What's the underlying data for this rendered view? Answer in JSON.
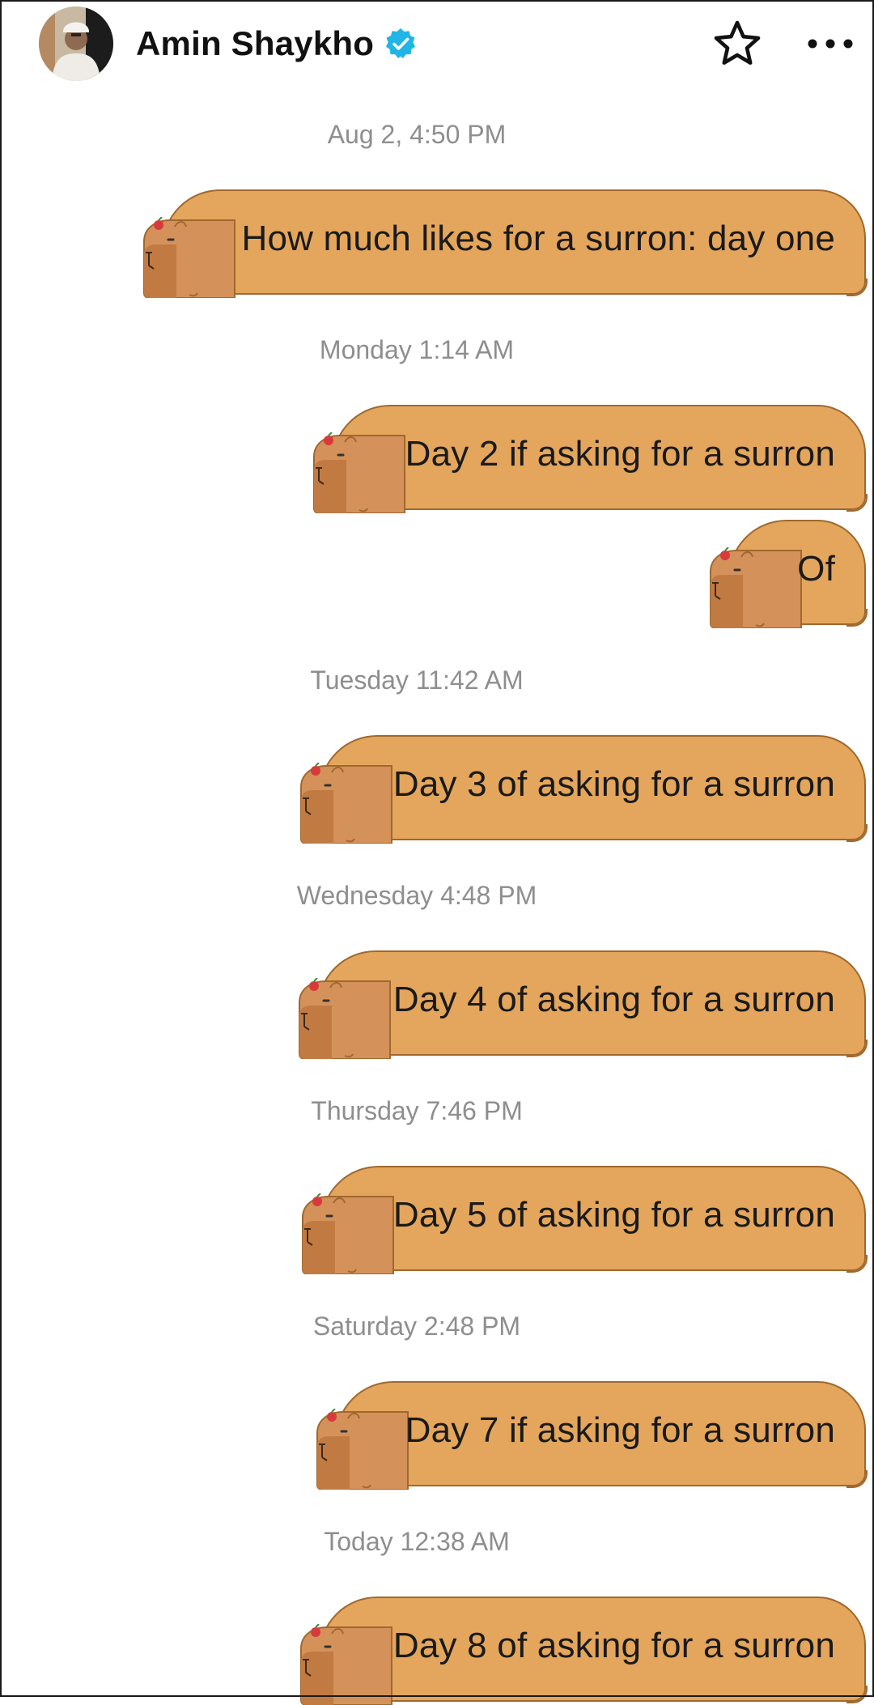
{
  "header": {
    "contact_name": "Amin Shaykho",
    "verified_icon": "verified-badge-icon",
    "favorite_icon": "star-outline-icon",
    "more_icon": "more-horizontal-icon",
    "accent_color": "#1fb6e6"
  },
  "conversation": {
    "bubble_color": "#e3a65c",
    "bubble_outline": "#a0682e",
    "timestamps": [
      "Aug 2, 4:50 PM",
      "Monday 1:14 AM",
      "Tuesday 11:42 AM",
      "Wednesday 4:48 PM",
      "Thursday 7:46 PM",
      "Saturday 2:48 PM",
      "Today 12:38 AM"
    ],
    "messages": [
      "How much likes for a surron: day one",
      "Day 2 if asking for a surron",
      "Of",
      "Day 3 of asking for a surron",
      "Day 4 of asking for a surron",
      "Day 5 of asking for a surron",
      "Day 7 if asking for a surron",
      "Day 8 of asking for a surron"
    ]
  }
}
